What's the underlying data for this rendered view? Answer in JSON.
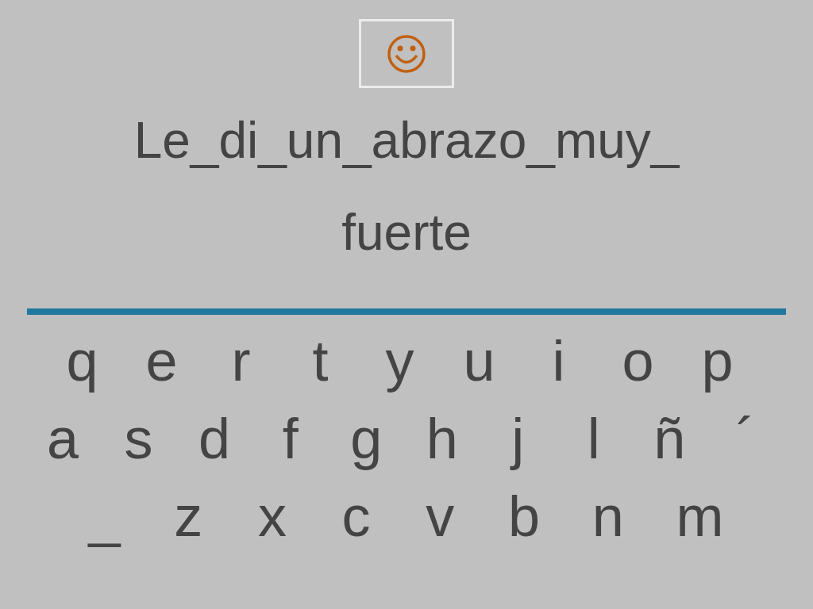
{
  "sentence_lines": [
    "Le_di_un_abrazo_muy_",
    "fuerte"
  ],
  "keyboard_rows": [
    [
      "q",
      "e",
      "r",
      "t",
      "y",
      "u",
      "i",
      "o",
      "p"
    ],
    [
      "a",
      "s",
      "d",
      "f",
      "g",
      "h",
      "j",
      "l",
      "ñ",
      "´"
    ],
    [
      "_",
      "z",
      "x",
      "c",
      "v",
      "b",
      "n",
      "m"
    ]
  ]
}
